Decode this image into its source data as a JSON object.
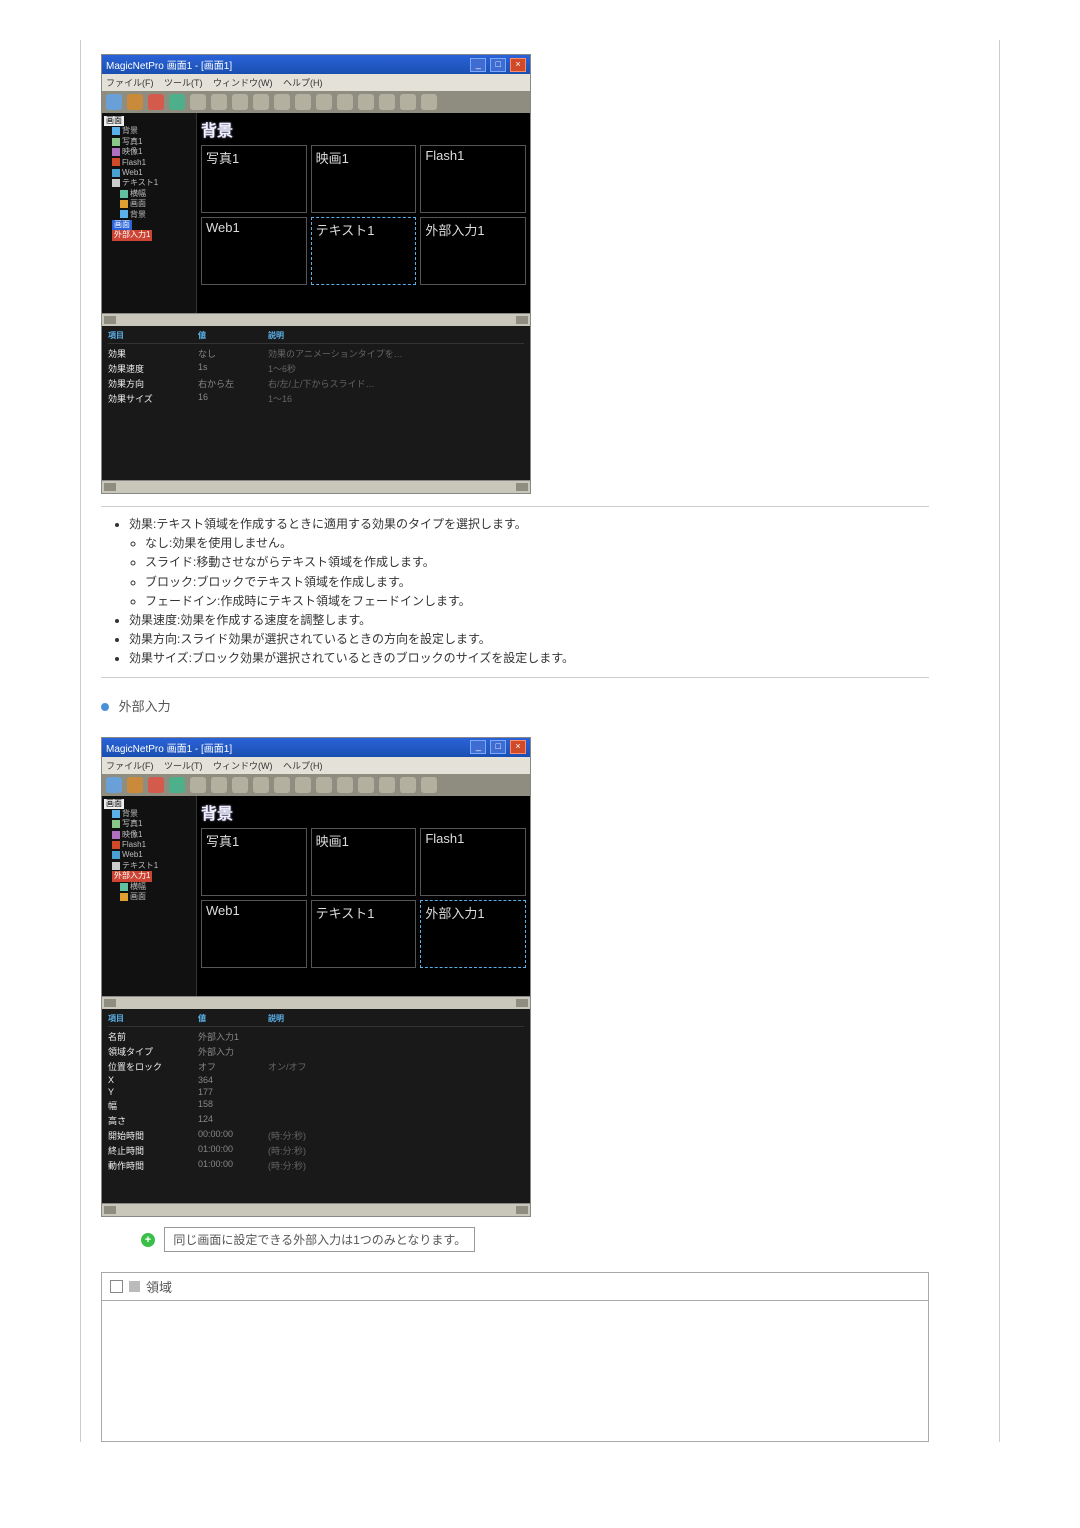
{
  "app": {
    "title": "MagicNetPro 画面1 - [画面1]",
    "menus": [
      "ファイル(F)",
      "ツール(T)",
      "ウィンドウ(W)",
      "ヘルプ(H)"
    ]
  },
  "canvas": {
    "title": "背景"
  },
  "tiles": {
    "a": "写真1",
    "b": "映画1",
    "c": "Flash1",
    "d": "Web1",
    "e": "テキスト1",
    "f": "外部入力1"
  },
  "tree1": {
    "root": "画面",
    "items": [
      "背景",
      "写真1",
      "映像1",
      "Flash1",
      "Web1",
      "テキスト1"
    ],
    "sub": [
      "横幅",
      "画面",
      "背景"
    ],
    "hl_blue": "画面",
    "hl_red": "外部入力1"
  },
  "tree2": {
    "root": "画面",
    "items": [
      "背景",
      "写真1",
      "映像1",
      "Flash1",
      "Web1",
      "テキスト1"
    ],
    "hl_red": "外部入力1",
    "sub": [
      "横幅",
      "画面"
    ]
  },
  "props_head": {
    "c1": "項目",
    "c2": "値",
    "c3": "説明"
  },
  "props1": [
    {
      "k": "効果",
      "v": "なし",
      "d": "効果のアニメーションタイプを…"
    },
    {
      "k": "効果速度",
      "v": "1s",
      "d": "1～6秒"
    },
    {
      "k": "効果方向",
      "v": "右から左",
      "d": "右/左/上/下からスライド…"
    },
    {
      "k": "効果サイズ",
      "v": "16",
      "d": "1～16"
    }
  ],
  "props2": [
    {
      "k": "名前",
      "v": "外部入力1",
      "d": ""
    },
    {
      "k": "領域タイプ",
      "v": "外部入力",
      "d": ""
    },
    {
      "k": "位置をロック",
      "v": "オフ",
      "d": "オン/オフ"
    },
    {
      "k": "X",
      "v": "364",
      "d": ""
    },
    {
      "k": "Y",
      "v": "177",
      "d": ""
    },
    {
      "k": "幅",
      "v": "158",
      "d": ""
    },
    {
      "k": "高さ",
      "v": "124",
      "d": ""
    },
    {
      "k": "開始時間",
      "v": "00:00:00",
      "d": "(時:分:秒)"
    },
    {
      "k": "終止時間",
      "v": "01:00:00",
      "d": "(時:分:秒)"
    },
    {
      "k": "動作時間",
      "v": "01:00:00",
      "d": "(時:分:秒)"
    }
  ],
  "bullets": {
    "b1": "効果:テキスト領域を作成するときに適用する効果のタイプを選択します。",
    "c1": "なし:効果を使用しません。",
    "c2": "スライド:移動させながらテキスト領域を作成します。",
    "c3": "ブロック:ブロックでテキスト領域を作成します。",
    "c4": "フェードイン:作成時にテキスト領域をフェードインします。",
    "b2": "効果速度:効果を作成する速度を調整します。",
    "b3": "効果方向:スライド効果が選択されているときの方向を設定します。",
    "b4": "効果サイズ:ブロック効果が選択されているときのブロックのサイズを設定します。"
  },
  "section2": "外部入力",
  "note": "同じ画面に設定できる外部入力は1つのみとなります。",
  "footer_title": "領域"
}
